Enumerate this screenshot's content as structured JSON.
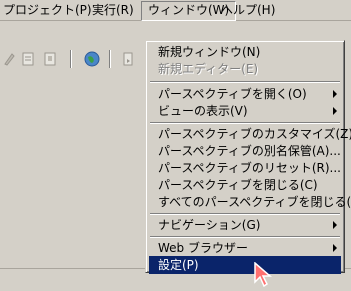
{
  "menubar": {
    "items": [
      "プロジェクト(P)",
      "実行(R)",
      "ウィンドウ(W)",
      "ヘルプ(H)"
    ]
  },
  "toolbar": {
    "icons": [
      "edit-icon",
      "document-icon",
      "file-icon",
      "globe-icon",
      "page-icon"
    ]
  },
  "window_menu": {
    "items": [
      {
        "label": "新規ウィンドウ(N)",
        "state": "normal"
      },
      {
        "label": "新規エディター(E)",
        "state": "disabled"
      },
      {
        "label": "パースペクティブを開く(O)",
        "state": "submenu"
      },
      {
        "label": "ビューの表示(V)",
        "state": "submenu"
      },
      {
        "label": "パースペクティブのカスタマイズ(Z)...",
        "state": "normal"
      },
      {
        "label": "パースペクティブの別名保管(A)...",
        "state": "normal"
      },
      {
        "label": "パースペクティブのリセット(R)...",
        "state": "normal"
      },
      {
        "label": "パースペクティブを閉じる(C)",
        "state": "normal"
      },
      {
        "label": "すべてのパースペクティブを閉じる(L)",
        "state": "normal"
      },
      {
        "label": "ナビゲーション(G)",
        "state": "submenu"
      },
      {
        "label": "Web ブラウザー",
        "state": "submenu"
      },
      {
        "label": "設定(P)",
        "state": "selected"
      }
    ]
  },
  "colors": {
    "menu_bg": "#d4d0c8",
    "selection": "#0a246a",
    "cursor_fill": "#ff7070"
  }
}
